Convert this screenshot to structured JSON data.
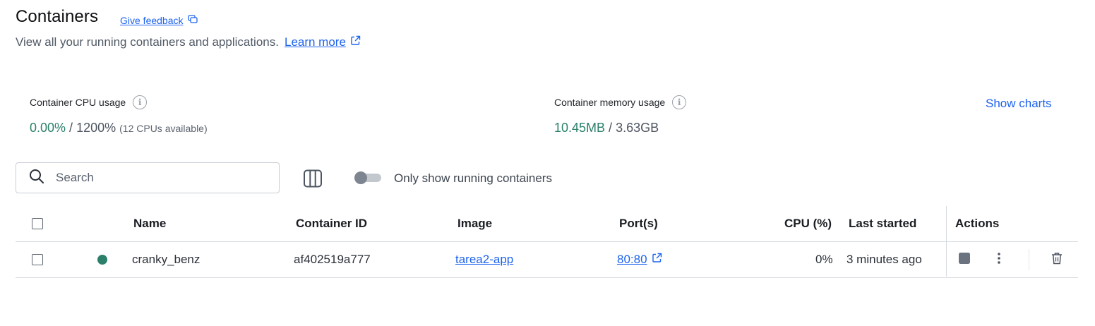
{
  "header": {
    "title": "Containers",
    "feedback_label": "Give feedback",
    "subtitle": "View all your running containers and applications.",
    "learn_more_label": "Learn more"
  },
  "stats": {
    "cpu": {
      "label": "Container CPU usage",
      "used": "0.00%",
      "separator": "/",
      "total": "1200%",
      "note": "(12 CPUs available)"
    },
    "memory": {
      "label": "Container memory usage",
      "used": "10.45MB",
      "separator": "/",
      "total": "3.63GB"
    },
    "show_charts_label": "Show charts"
  },
  "toolbar": {
    "search_placeholder": "Search",
    "toggle_label": "Only show running containers",
    "toggle_on": false
  },
  "table": {
    "columns": {
      "name": "Name",
      "container_id": "Container ID",
      "image": "Image",
      "ports": "Port(s)",
      "cpu": "CPU (%)",
      "last_started": "Last started",
      "actions": "Actions"
    },
    "rows": [
      {
        "name": "cranky_benz",
        "status": "running",
        "container_id": "af402519a777",
        "image": "tarea2-app",
        "ports": "80:80",
        "cpu": "0%",
        "last_started": "3 minutes ago"
      }
    ]
  },
  "colors": {
    "accent": "#1d63ed",
    "running": "#2b7f6b"
  }
}
